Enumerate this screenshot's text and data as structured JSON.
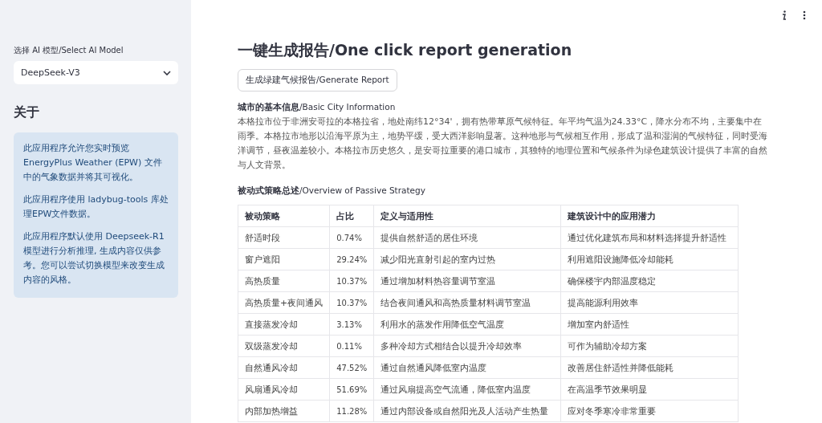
{
  "sidebar": {
    "model_select": {
      "label": "选择 AI 模型/Select AI Model",
      "value": "DeepSeek-V3"
    },
    "about": {
      "title": "关于",
      "paragraphs": [
        "此应用程序允许您实时预览 EnergyPlus Weather (EPW) 文件中的气象数据并将其可视化。",
        "此应用程序使用 ladybug-tools 库处理EPW文件数据。",
        "此应用程序默认使用 Deepseek-R1模型进行分析推理, 生成内容仅供参考。您可以尝试切换模型来改变生成内容的风格。"
      ]
    }
  },
  "main": {
    "title": "一键生成报告/One click report generation",
    "generate_button": "生成绿建气候报告/Generate Report",
    "city_info": {
      "heading": "**城市的基本信息**/Basic City Information",
      "text": "本格拉市位于非洲安哥拉的本格拉省，地处南纬12°34'，拥有热带草原气候特征。年平均气温为24.33°C，降水分布不均，主要集中在雨季。本格拉市地形以沿海平原为主，地势平缓，受大西洋影响显著。这种地形与气候相互作用，形成了温和湿润的气候特征，同时受海洋调节，昼夜温差较小。本格拉市历史悠久，是安哥拉重要的港口城市，其独特的地理位置和气候条件为绿色建筑设计提供了丰富的自然与人文背景。"
    },
    "strategy_heading": "**被动式策略总述**/Overview of Passive Strategy",
    "table": {
      "columns": [
        "被动策略",
        "占比",
        "定义与适用性",
        "建筑设计中的应用潜力"
      ],
      "rows": [
        [
          "舒适时段",
          "0.74%",
          "提供自然舒适的居住环境",
          "通过优化建筑布局和材料选择提升舒适性"
        ],
        [
          "窗户遮阳",
          "29.24%",
          "减少阳光直射引起的室内过热",
          "利用遮阳设施降低冷却能耗"
        ],
        [
          "高热质量",
          "10.37%",
          "通过增加材料热容量调节室温",
          "确保楼宇内部温度稳定"
        ],
        [
          "高热质量+夜间通风",
          "10.37%",
          "结合夜间通风和高热质量材料调节室温",
          "提高能源利用效率"
        ],
        [
          "直接蒸发冷却",
          "3.13%",
          "利用水的蒸发作用降低空气温度",
          "增加室内舒适性"
        ],
        [
          "双级蒸发冷却",
          "0.11%",
          "多种冷却方式相结合以提升冷却效率",
          "可作为辅助冷却方案"
        ],
        [
          "自然通风冷却",
          "47.52%",
          "通过自然通风降低室内温度",
          "改善居住舒适性并降低能耗"
        ],
        [
          "风扇通风冷却",
          "51.69%",
          "通过风扇提高空气流通，降低室内温度",
          "在高温季节效果明显"
        ],
        [
          "内部加热增益",
          "11.28%",
          "通过内部设备或自然阳光及人活动产生热量",
          "应对冬季寒冷非常重要"
        ]
      ]
    }
  }
}
